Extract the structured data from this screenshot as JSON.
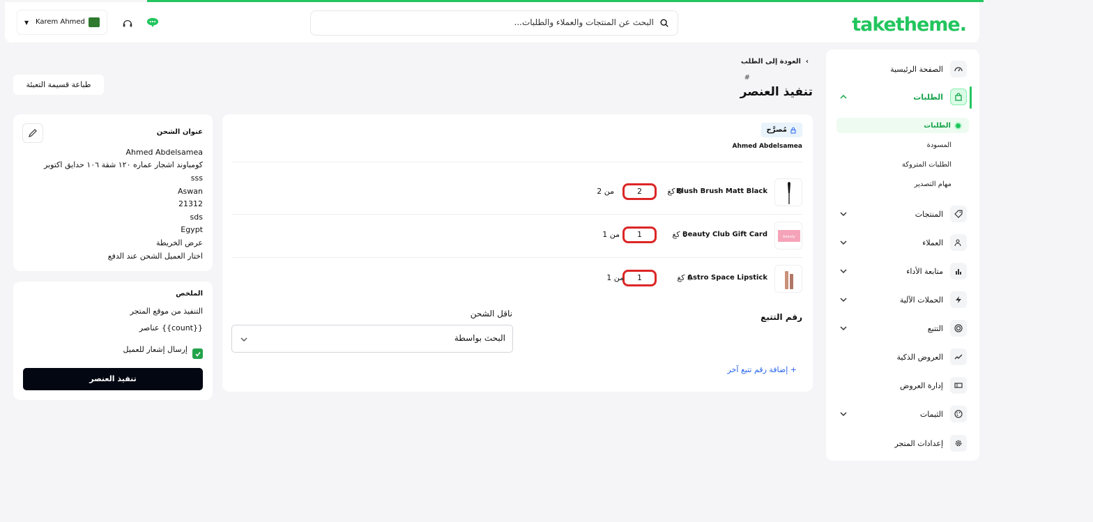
{
  "header": {
    "logo": "taketheme.",
    "search_placeholder": "البحث عن المنتجات والعملاء والطلبات...",
    "user_name": "Karem Ahmed"
  },
  "sidebar": {
    "items": [
      {
        "label": "الصفحة الرئيسية",
        "icon": "dashboard-icon"
      },
      {
        "label": "الطلبات",
        "icon": "shopping-bag-icon"
      },
      {
        "label": "المنتجات",
        "icon": "tag-icon"
      },
      {
        "label": "العملاء",
        "icon": "users-icon"
      },
      {
        "label": "متابعة الأداء",
        "icon": "bar-chart-icon"
      },
      {
        "label": "الحملات الآلية",
        "icon": "lightning-icon"
      },
      {
        "label": "التتبع",
        "icon": "target-icon"
      },
      {
        "label": "العروض الذكية",
        "icon": "trend-icon"
      },
      {
        "label": "إدارة العروض",
        "icon": "ticket-icon"
      },
      {
        "label": "الثيمات",
        "icon": "palette-icon"
      },
      {
        "label": "إعدادات المتجر",
        "icon": "gear-icon"
      }
    ],
    "orders_sub": [
      {
        "label": "الطلبات"
      },
      {
        "label": "المسودة"
      },
      {
        "label": "الطلبات المتروكة"
      },
      {
        "label": "مهام التصدير"
      }
    ]
  },
  "page": {
    "back_label": "العودة إلى الطلب",
    "hash": "#",
    "title": "تنفيذ العنصر",
    "print_label": "طباعة قسيمة التعبئة"
  },
  "fulfillment": {
    "badge": "مُصرَّح",
    "customer": "Ahmed Abdelsamea",
    "items": [
      {
        "name": "Blush Brush Matt Black",
        "weight": "0 كغ",
        "qty": "2",
        "of": "من 2"
      },
      {
        "name": "Beauty Club Gift Card",
        "weight": "0 كغ",
        "qty": "1",
        "of": "من 1"
      },
      {
        "name": "Astro Space Lipstick",
        "weight": "0 كغ",
        "qty": "1",
        "of": "من 1"
      }
    ],
    "tracking_label": "رقم التتبع",
    "carrier_label": "ناقل الشحن",
    "carrier_value": "البحث بواسطة",
    "add_tracking": "+ إضافة رقم تتبع آخر"
  },
  "shipping": {
    "title": "عنوان الشحن",
    "lines": [
      "Ahmed Abdelsamea",
      "كومباوند اشجار عماره ١٢٠ شقة ١٠٦ حدايق اكتوبر",
      "sss",
      "Aswan",
      "21312",
      "sds",
      "Egypt",
      "عرض الخريطة",
      "اختار العميل الشحن عند الدفع"
    ]
  },
  "summary": {
    "title": "الملخص",
    "source": "التنفيذ من موقع المتجر",
    "count": "{{count}} عناصر",
    "notify_label": "إرسال إشعار للعميل",
    "fulfill_button": "تنفيذ العنصر"
  },
  "colors": {
    "accent": "#22c55e",
    "highlight": "#dc2626",
    "primary_button": "#030712"
  }
}
